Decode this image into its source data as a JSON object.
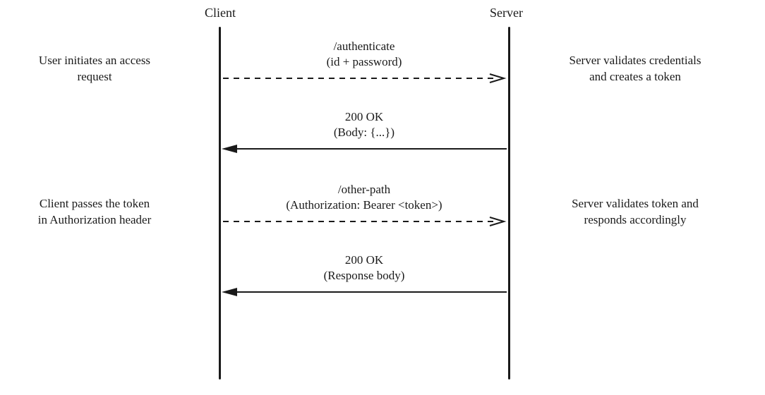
{
  "participants": {
    "client": "Client",
    "server": "Server"
  },
  "notes": {
    "left1": "User initiates an access\nrequest",
    "right1": "Server validates credentials\nand creates a token",
    "left2": "Client passes the token\nin Authorization header",
    "right2": "Server validates token and\nresponds accordingly"
  },
  "messages": {
    "m1_line1": "/authenticate",
    "m1_line2": "(id + password)",
    "m2_line1": "200 OK",
    "m2_line2": "(Body: {...})",
    "m3_line1": "/other-path",
    "m3_line2": "(Authorization: Bearer <token>)",
    "m4_line1": "200 OK",
    "m4_line2": "(Response body)"
  }
}
